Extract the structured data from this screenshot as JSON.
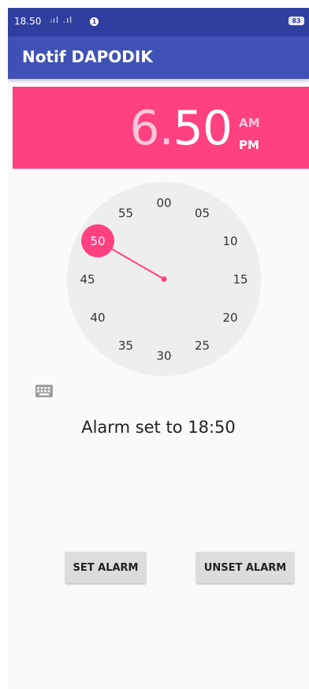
{
  "status_bar": {
    "time": "18.50",
    "signal": "ᵢıl .ıl",
    "notification": "1",
    "battery": "83"
  },
  "app_bar": {
    "title": "Notif DAPODIK"
  },
  "time_picker": {
    "hour": "6",
    "separator": ".",
    "minute": "50",
    "am_label": "AM",
    "pm_label": "PM",
    "selected_period": "PM",
    "selected_minute": 50,
    "dial_labels": [
      "00",
      "05",
      "10",
      "15",
      "20",
      "25",
      "30",
      "35",
      "40",
      "45",
      "50",
      "55"
    ],
    "accent_color": "#ff4081",
    "dial_color": "#eeeeee"
  },
  "keyboard_toggle": {
    "icon": "keyboard-icon"
  },
  "alarm_status": "Alarm set to 18:50",
  "buttons": {
    "set_label": "SET ALARM",
    "unset_label": "UNSET ALARM"
  },
  "colors": {
    "primary": "#3f51b5",
    "primary_dark": "#303f9f",
    "accent": "#ff4081"
  }
}
